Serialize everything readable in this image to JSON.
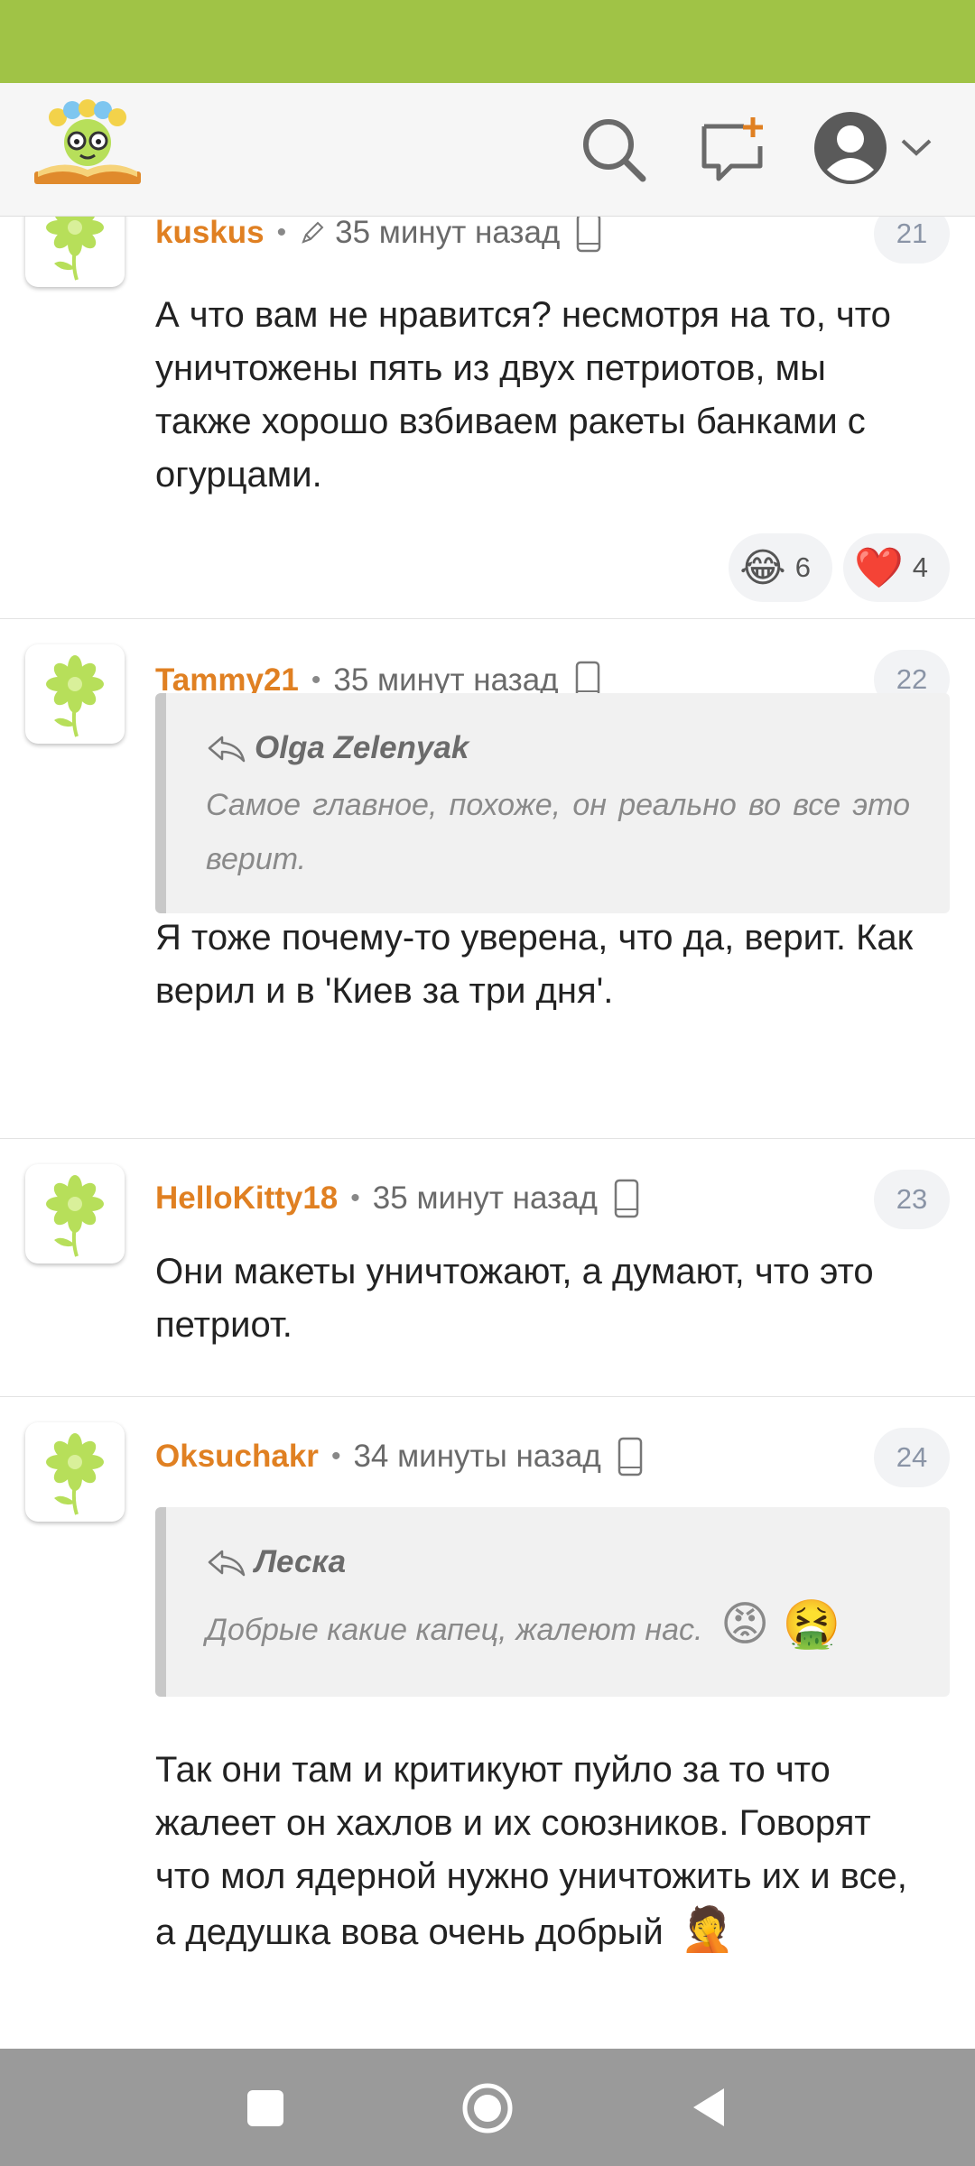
{
  "icons": {
    "search": "search-icon",
    "new_post": "add-comment-icon",
    "profile": "user-avatar-icon",
    "dropdown": "chevron-down-icon",
    "device": "phone-icon",
    "reply": "reply-arrow-icon"
  },
  "colors": {
    "statusbar": "#a0c346",
    "author": "#e08022",
    "accent_green": "#b7df5a"
  },
  "comments": [
    {
      "author": "kuskus",
      "time": "35 минут назад",
      "edited": true,
      "number": "21",
      "text": "А что вам не нравится? несмотря на то, что уничтожены пять из двух петриотов, мы также хорошо взбиваем ракеты банками с огурцами.",
      "reactions": [
        {
          "emoji": "😂",
          "count": "6"
        },
        {
          "emoji": "❤️",
          "count": "4"
        }
      ]
    },
    {
      "author": "Tammy21",
      "time": "35 минут назад",
      "number": "22",
      "quote": {
        "author": "Olga Zelenyak",
        "text": "Самое главное, похоже, он реально во все это верит."
      },
      "text": "Я тоже почему-то уверена, что да, верит. Как верил и в 'Киев за три дня'."
    },
    {
      "author": "HelloKitty18",
      "time": "35 минут назад",
      "number": "23",
      "text": "Они макеты уничтожают, а думают, что это петриот."
    },
    {
      "author": "Oksuchakr",
      "time": "34 минуты назад",
      "number": "24",
      "quote": {
        "author": "Леска",
        "text": "Добрые какие капец, жалеют нас.",
        "emojis": "😡 🤮"
      },
      "text": "Так они там и критикуют пуйло за то что жалеет он хахлов и их союзников. Говорят что мол ядерной нужно уничтожить их и все, а дедушка вова очень добрый",
      "text_emoji": "🤦"
    }
  ],
  "nav": {
    "recents": "square-icon",
    "home": "circle-icon",
    "back": "triangle-back-icon"
  }
}
